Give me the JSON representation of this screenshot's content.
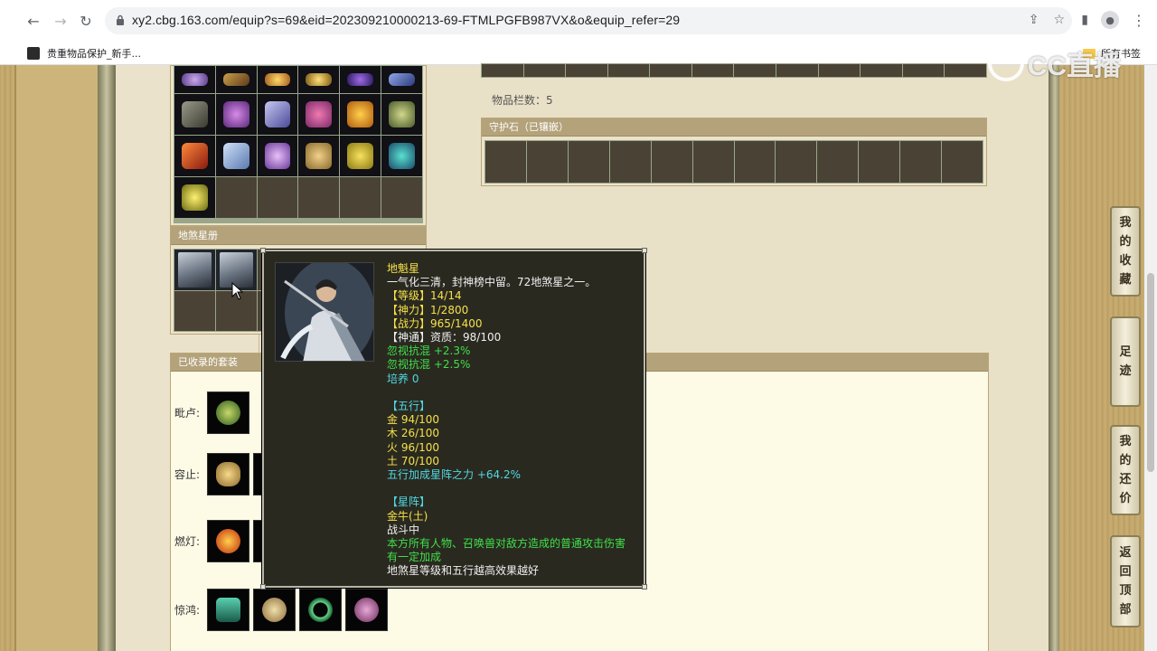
{
  "browser": {
    "url": "xy2.cbg.163.com/equip?s=69&eid=202309210000213-69-FTMLPGFB987VX&o&equip_refer=29",
    "bookmark_label": "贵重物品保护_新手...",
    "bookmarks_folder_label": "所有书签"
  },
  "watermark": {
    "text": "CC直播"
  },
  "inventory": {
    "count_text": "物品栏数：5"
  },
  "panels": {
    "guard_stone_title": "守护石（已镶嵌）",
    "star_book_title": "地煞星册",
    "collected_suits_title": "已收录的套装"
  },
  "suits": [
    {
      "label": "毗卢:"
    },
    {
      "label": "容止:"
    },
    {
      "label": "燃灯:"
    },
    {
      "label": "惊鸿:"
    }
  ],
  "side_nav": {
    "favorites": "我的收藏",
    "footprints": "足迹",
    "bargain": "我的还价",
    "back_top": "返回顶部"
  },
  "tooltip": {
    "lines": [
      {
        "text": "地魁星",
        "color": "yellow"
      },
      {
        "text": "一气化三清，封神榜中留。72地煞星之一。",
        "color": "white"
      },
      {
        "text": "【等级】14/14",
        "color": "yellow"
      },
      {
        "text": "【神力】1/2800",
        "color": "yellow"
      },
      {
        "text": "【战力】965/1400",
        "color": "yellow"
      },
      {
        "text": "【神通】资质：98/100",
        "color": "white"
      },
      {
        "text": "忽视抗混 +2.3%",
        "color": "green"
      },
      {
        "text": "忽视抗混 +2.5%",
        "color": "green"
      },
      {
        "text": "培养 0",
        "color": "cyan"
      },
      {
        "text": "",
        "color": "white"
      },
      {
        "text": "【五行】",
        "color": "cyan"
      },
      {
        "text": "金 94/100",
        "color": "yellow"
      },
      {
        "text": "木 26/100",
        "color": "yellow"
      },
      {
        "text": "火 96/100",
        "color": "yellow"
      },
      {
        "text": "土 70/100",
        "color": "yellow"
      },
      {
        "text": "五行加成星阵之力 +64.2%",
        "color": "cyan"
      },
      {
        "text": "",
        "color": "white"
      },
      {
        "text": "【星阵】",
        "color": "cyan"
      },
      {
        "text": "金牛(土)",
        "color": "yellow"
      },
      {
        "text": "战斗中",
        "color": "white"
      },
      {
        "text": "本方所有人物、召唤兽对敌方造成的普通攻击伤害",
        "color": "green"
      },
      {
        "text": "有一定加成",
        "color": "green"
      },
      {
        "text": "地煞星等级和五行越高效果越好",
        "color": "white"
      }
    ]
  },
  "colors": {
    "tooltip_bg": "#2a2920",
    "yellow": "#f5e14a",
    "green": "#3fe04a",
    "cyan": "#4fd8e0",
    "panel_header": "#b3a27a"
  }
}
